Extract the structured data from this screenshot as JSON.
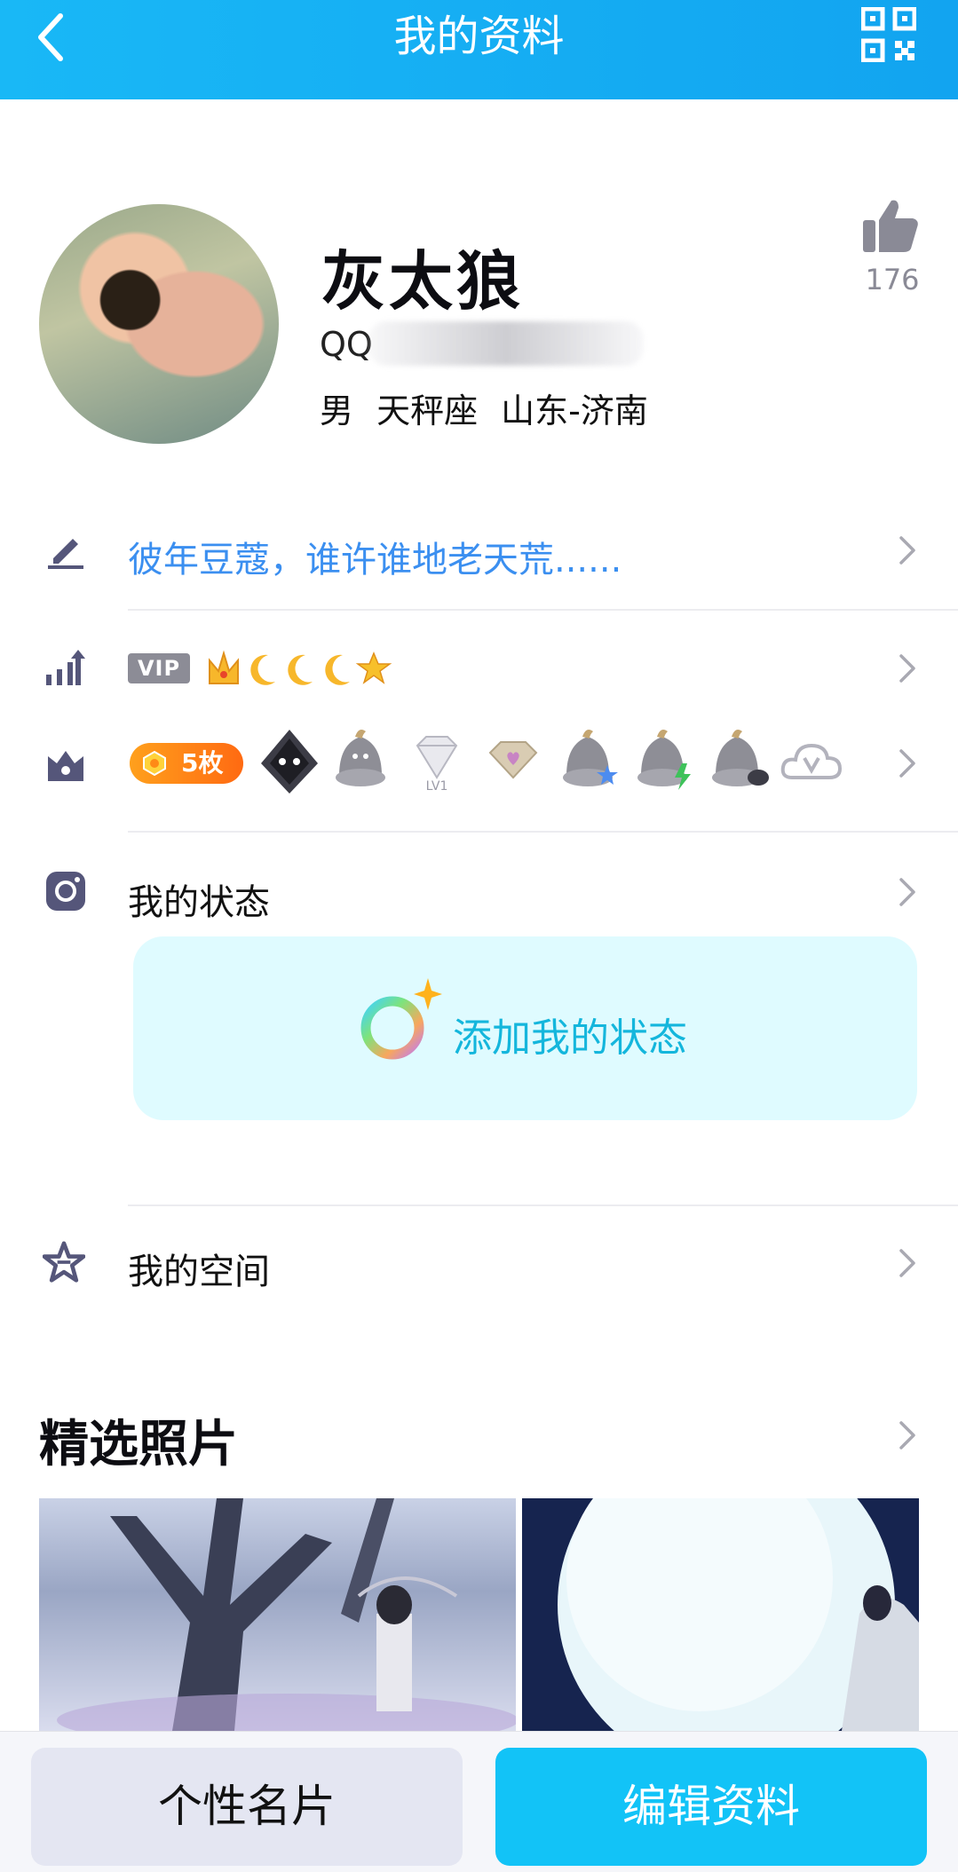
{
  "header": {
    "title": "我的资料",
    "back_icon": "chevron-left-icon",
    "qr_icon": "qr-code-icon"
  },
  "profile": {
    "nickname": "灰太狼",
    "qq_label": "QQ",
    "info": "男 天秤座 山东-济南",
    "likes": "176"
  },
  "rows": {
    "signature": {
      "icon": "edit-pen-icon",
      "text": "彼年豆蔻，谁许谁地老天荒......"
    },
    "level": {
      "icon": "level-chart-icon",
      "vip_label": "VIP",
      "level_icons": [
        "crown-icon",
        "moon-icon",
        "moon-icon",
        "moon-icon",
        "star-icon"
      ]
    },
    "medals": {
      "icon": "medal-box-icon",
      "medal_count": "5枚",
      "lv_label": "LV1"
    },
    "status": {
      "icon": "camera-icon",
      "label": "我的状态",
      "add_label": "添加我的状态"
    },
    "space": {
      "icon": "star-space-icon",
      "label": "我的空间"
    }
  },
  "photos": {
    "title": "精选照片"
  },
  "bottom": {
    "card_button": "个性名片",
    "edit_button": "编辑资料"
  },
  "colors": {
    "accent": "#12c3f7",
    "header": "#19b8f6",
    "link": "#3b8ff0",
    "medal": "#ff8a16"
  }
}
